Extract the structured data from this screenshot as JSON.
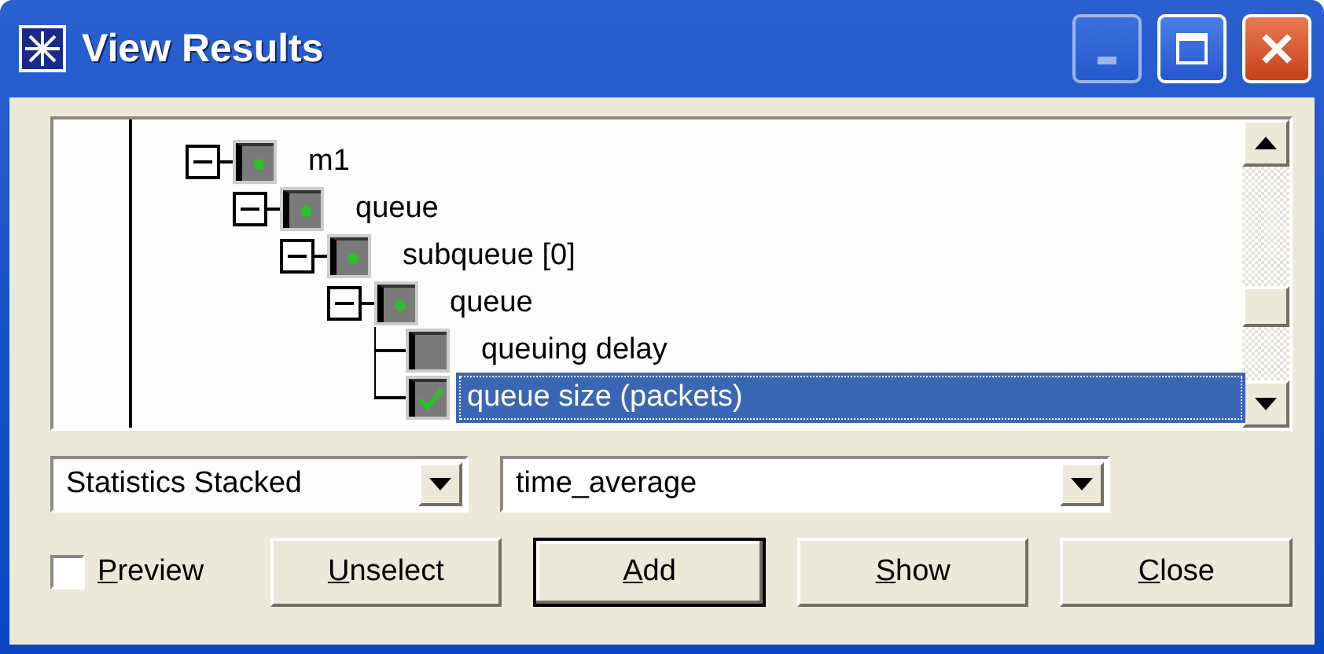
{
  "window": {
    "title": "View Results"
  },
  "tree": [
    {
      "label": "m1",
      "expanded": true,
      "selected": false,
      "children": [
        {
          "label": "queue",
          "expanded": true,
          "selected": false,
          "children": [
            {
              "label": "subqueue [0]",
              "expanded": true,
              "selected": false,
              "children": [
                {
                  "label": "queue",
                  "expanded": true,
                  "selected": false,
                  "children": [
                    {
                      "label": "queuing delay",
                      "checked": false,
                      "selected": false
                    },
                    {
                      "label": "queue size (packets)",
                      "checked": true,
                      "selected": true
                    }
                  ]
                }
              ]
            }
          ]
        }
      ]
    }
  ],
  "dropdowns": [
    {
      "value": "Statistics Stacked"
    },
    {
      "value": "time_average"
    }
  ],
  "preview": {
    "label": "Preview",
    "checked": false
  },
  "buttons": [
    {
      "label": "Unselect",
      "default": false
    },
    {
      "label": "Add",
      "default": true
    },
    {
      "label": "Show",
      "default": false
    },
    {
      "label": "Close",
      "default": false
    }
  ]
}
